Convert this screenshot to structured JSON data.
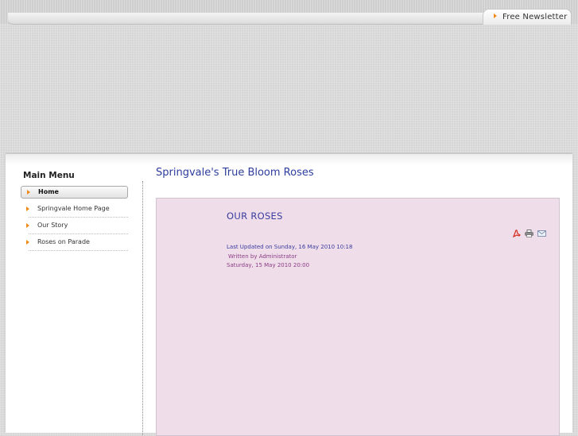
{
  "header": {
    "newsletter_label": "Free Newsletter"
  },
  "sidebar": {
    "title": "Main Menu",
    "items": [
      {
        "label": "Home",
        "active": true
      },
      {
        "label": "Springvale Home Page",
        "active": false
      },
      {
        "label": "Our Story",
        "active": false
      },
      {
        "label": "Roses on Parade",
        "active": false
      }
    ]
  },
  "main": {
    "heading": "Springvale's True Bloom Roses",
    "article": {
      "title": "OUR ROSES",
      "last_updated": "Last Updated on Sunday, 16 May 2010 10:18",
      "author": "Written by Administrator",
      "date": "Saturday, 15 May 2010 20:00",
      "icons": [
        "pdf-icon",
        "print-icon",
        "email-icon"
      ]
    }
  },
  "colors": {
    "accent_orange": "#f08a1a",
    "heading_blue": "#2c3d9c",
    "article_bg": "#efdde9",
    "meta_purple": "#8a3d86"
  }
}
